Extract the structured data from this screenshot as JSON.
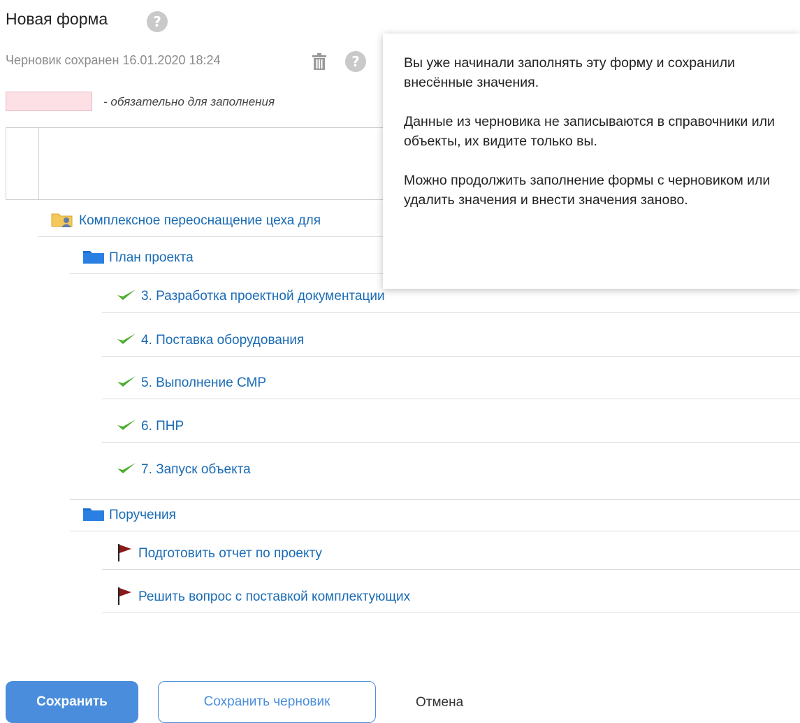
{
  "header": {
    "title": "Новая форма",
    "help_glyph": "?",
    "draft_status": "Черновик сохранен 16.01.2020 18:24"
  },
  "legend": {
    "required_text": "- обязательно для заполнения",
    "required_color": "#fde0e6"
  },
  "tree": {
    "root": {
      "label": "Комплексное переоснащение цеха для",
      "icon": "project-folder-icon"
    },
    "groups": [
      {
        "label": "План проекта",
        "icon": "folder-icon",
        "items": [
          {
            "label": "3. Разработка проектной документации",
            "icon": "checkmark-icon"
          },
          {
            "label": "4. Поставка оборудования",
            "icon": "checkmark-icon"
          },
          {
            "label": "5. Выполнение СМР",
            "icon": "checkmark-icon"
          },
          {
            "label": "6. ПНР",
            "icon": "checkmark-icon"
          },
          {
            "label": "7. Запуск объекта",
            "icon": "checkmark-icon"
          }
        ]
      },
      {
        "label": "Поручения",
        "icon": "folder-icon",
        "items": [
          {
            "label": "Подготовить отчет по проекту",
            "icon": "flag-icon"
          },
          {
            "label": "Решить вопрос с поставкой комплектующих",
            "icon": "flag-icon"
          }
        ]
      }
    ]
  },
  "tooltip": {
    "p1": "Вы уже начинали заполнять эту форму и сохранили внесённые значения.",
    "p2": "Данные из черновика не записываются в справочники или объекты, их видите только вы.",
    "p3": "Можно продолжить заполнение формы с черновиком или удалить значения и внести значения заново."
  },
  "buttons": {
    "save": "Сохранить",
    "save_draft": "Сохранить черновик",
    "cancel": "Отмена"
  },
  "colors": {
    "accent": "#4a8ddc",
    "link": "#1a6bb5",
    "check": "#4caf2e",
    "flag": "#8b1a1a",
    "folder": "#1d6fd1"
  }
}
